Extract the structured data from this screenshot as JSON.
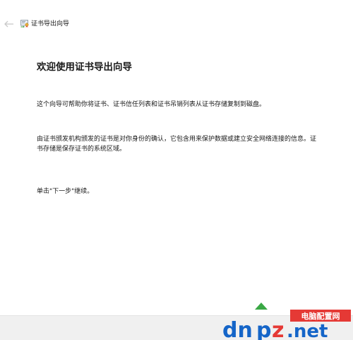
{
  "window": {
    "title": "证书导出向导",
    "back_icon": "back-arrow-icon",
    "title_icon": "certificate-wizard-icon"
  },
  "main": {
    "heading": "欢迎使用证书导出向导",
    "paragraph1": "这个向导可帮助你将证书、证书信任列表和证书吊销列表从证书存储复制到磁盘。",
    "paragraph2": "由证书颁发机构颁发的证书是对你身份的确认，它包含用来保护数据或建立安全网络连接的信息。证书存储是保存证书的系统区域。",
    "paragraph3": "单击\"下一步\"继续。"
  },
  "watermark": {
    "site_name": "电脑配置网",
    "logo_text": "dnpz.net"
  },
  "colors": {
    "background": "#ffffff",
    "footer": "#f0f0f0",
    "text": "#1a1a1a",
    "watermark_blue": "#1565c8",
    "watermark_red": "#e53935",
    "watermark_green": "#3aa845"
  }
}
